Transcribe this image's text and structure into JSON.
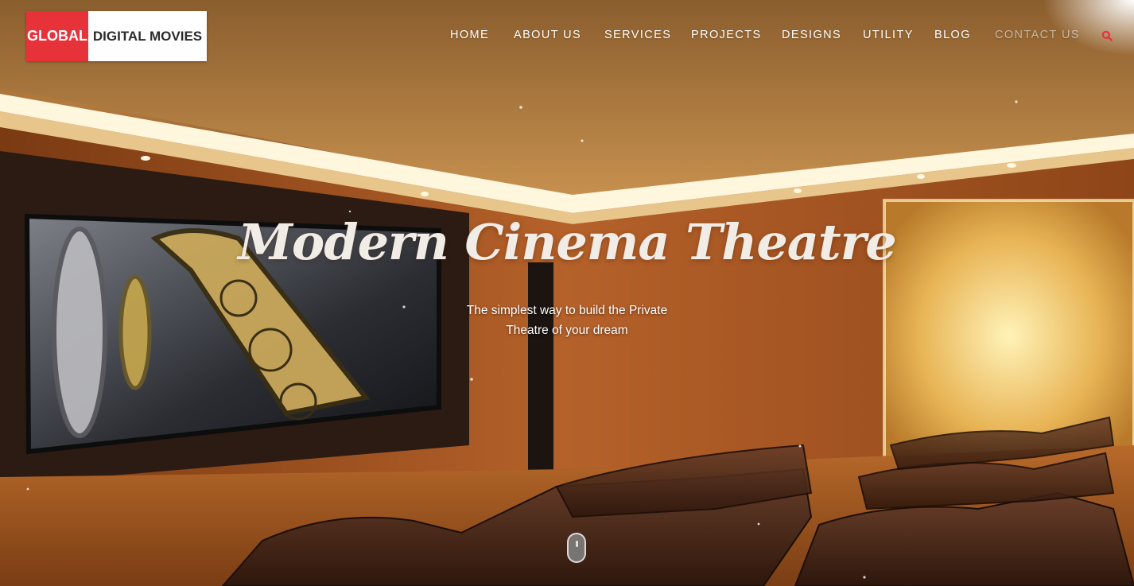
{
  "logo": {
    "part1": "GLOBAL",
    "part2": "DIGITAL MOVIES"
  },
  "nav": {
    "items": [
      "HOME",
      "ABOUT US",
      "SERVICES",
      "PROJECTS",
      "DESIGNS",
      "UTILITY",
      "BLOG",
      "CONTACT US"
    ],
    "search_icon": "search-icon"
  },
  "hero": {
    "title": "Modern Cinema Theatre",
    "subtitle_line1": "The simplest way to build the Private",
    "subtitle_line2": "Theatre of your dream"
  },
  "scroll_indicator_icon": "mouse-scroll-icon",
  "colors": {
    "brand_red": "#e8323a",
    "search_accent": "#e8323a"
  }
}
